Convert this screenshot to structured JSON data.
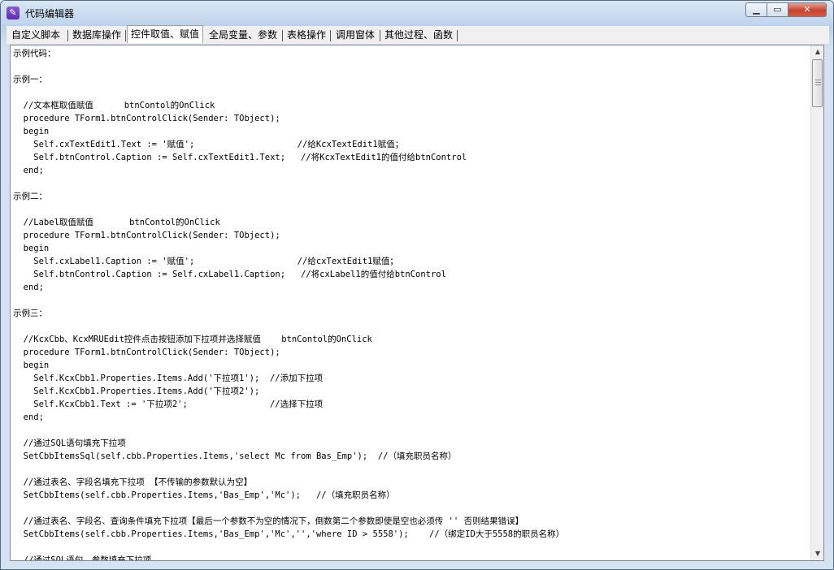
{
  "window": {
    "title": "代码编辑器",
    "app_icon": "editor-app-icon",
    "controls": {
      "minimize": "minimize-icon",
      "maximize": "maximize-icon",
      "close": "close-icon"
    }
  },
  "tabs": [
    {
      "label": "自定义脚本",
      "active": false
    },
    {
      "label": "数据库操作",
      "active": false
    },
    {
      "label": "控件取值、赋值",
      "active": true
    },
    {
      "label": "全局变量、参数",
      "active": false
    },
    {
      "label": "表格操作",
      "active": false
    },
    {
      "label": "调用窗体",
      "active": false
    },
    {
      "label": "其他过程、函数",
      "active": false
    }
  ],
  "editor": {
    "lines": [
      "示例代码：",
      "",
      "示例一：",
      "",
      "  //文本框取值赋值      btnContol的OnClick",
      "  procedure TForm1.btnControlClick(Sender: TObject);",
      "  begin",
      "    Self.cxTextEdit1.Text := '赋值';                    //给KcxTextEdit1赋值；",
      "    Self.btnControl.Caption := Self.cxTextEdit1.Text;   //将KcxTextEdit1的值付给btnControl",
      "  end;",
      "",
      "示例二：",
      "",
      "  //Label取值赋值       btnContol的OnClick",
      "  procedure TForm1.btnControlClick(Sender: TObject);",
      "  begin",
      "    Self.cxLabel1.Caption := '赋值';                    //给cxTextEdit1赋值；",
      "    Self.btnControl.Caption := Self.cxLabel1.Caption;   //将cxLabel1的值付给btnControl",
      "  end;",
      "",
      "示例三：",
      "",
      "  //KcxCbb、KcxMRUEdit控件点击按钮添加下拉项并选择赋值    btnContol的OnClick",
      "  procedure TForm1.btnControlClick(Sender: TObject);",
      "  begin",
      "    Self.KcxCbb1.Properties.Items.Add('下拉项1');  //添加下拉项",
      "    Self.KcxCbb1.Properties.Items.Add('下拉项2');",
      "    Self.KcxCbb1.Text := '下拉项2';                //选择下拉项",
      "  end;",
      "",
      "  //通过SQL语句填充下拉项",
      "  SetCbbItemsSql(self.cbb.Properties.Items,'select Mc from Bas_Emp');  //（填充职员名称）",
      "",
      "  //通过表名、字段名填充下拉项 【不传输的参数默认为空】",
      "  SetCbbItems(self.cbb.Properties.Items,'Bas_Emp','Mc');   //（填充职员名称）",
      "",
      "  //通过表名、字段名、查询条件填充下拉项【最后一个参数不为空的情况下，倒数第二个参数即使是空也必须传 '' 否则结果错误】",
      "  SetCbbItems(self.cbb.Properties.Items,'Bas_Emp','Mc','','where ID > 5558');    //（绑定ID大于5558的职员名称）",
      "",
      "  //通过SQL语句、参数填充下拉项"
    ]
  },
  "scrollbar": {
    "up_icon": "scroll-up-arrow-icon",
    "down_icon": "scroll-down-arrow-icon",
    "position_fraction": 0.0
  }
}
